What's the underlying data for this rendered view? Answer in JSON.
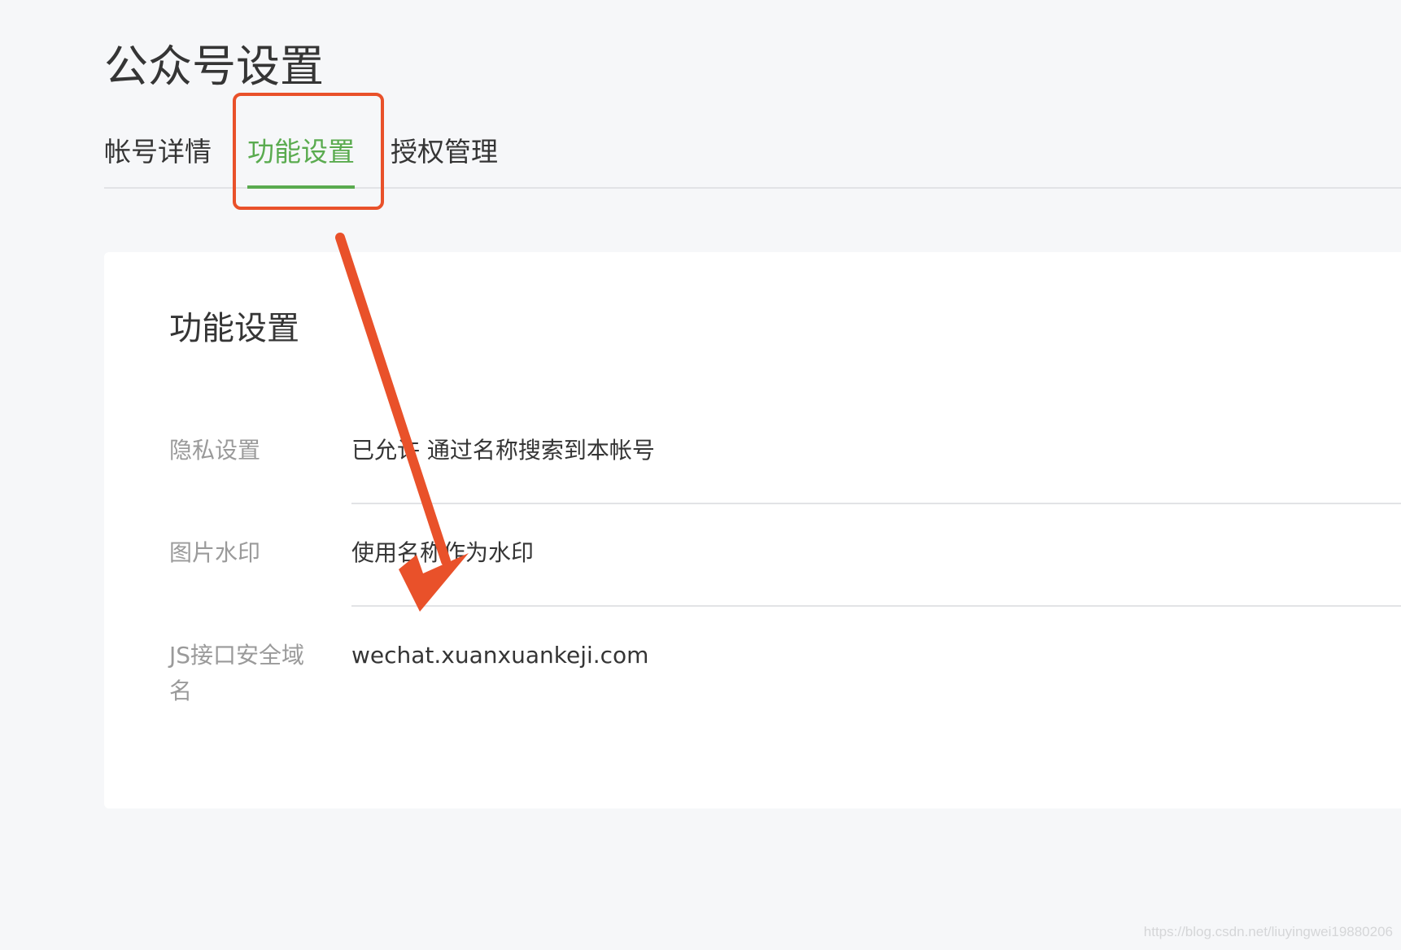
{
  "page": {
    "title": "公众号设置"
  },
  "tabs": [
    {
      "label": "帐号详情",
      "active": false
    },
    {
      "label": "功能设置",
      "active": true
    },
    {
      "label": "授权管理",
      "active": false
    }
  ],
  "card": {
    "title": "功能设置",
    "rows": [
      {
        "label": "隐私设置",
        "value": "已允许 通过名称搜索到本帐号"
      },
      {
        "label": "图片水印",
        "value": "使用名称作为水印"
      },
      {
        "label": "JS接口安全域名",
        "value": "wechat.xuanxuankeji.com"
      }
    ]
  },
  "annotation": {
    "color": "#e9512a"
  },
  "colors": {
    "accent": "#5aab4f",
    "background": "#f6f7f9",
    "card": "#ffffff",
    "label": "#9a9a9a",
    "text": "#353535"
  },
  "watermark": "https://blog.csdn.net/liuyingwei19880206"
}
